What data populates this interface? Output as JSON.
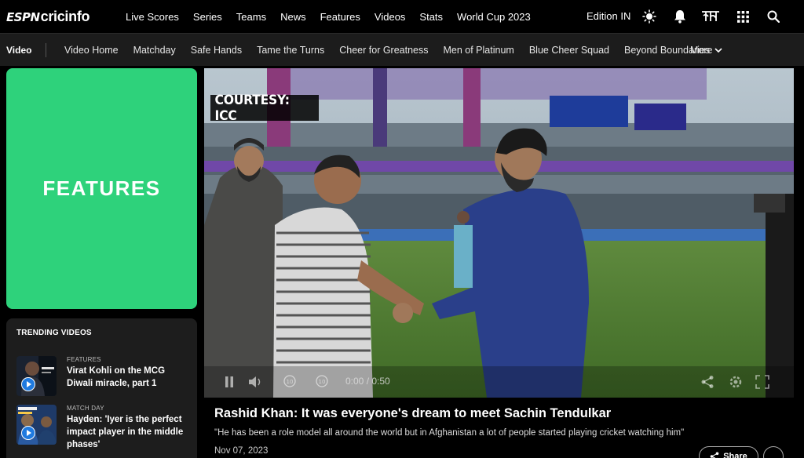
{
  "brand": {
    "espn": "ESPN",
    "cricinfo": "cricinfo"
  },
  "topnav": {
    "links": [
      "Live Scores",
      "Series",
      "Teams",
      "News",
      "Features",
      "Videos",
      "Stats",
      "World Cup 2023"
    ],
    "edition": "Edition IN",
    "icons": [
      "brightness-icon",
      "notification-bell-icon",
      "hindi-language-icon",
      "apps-grid-icon",
      "search-icon"
    ]
  },
  "subnav": {
    "section": "Video",
    "links": [
      "Video Home",
      "Matchday",
      "Safe Hands",
      "Tame the Turns",
      "Cheer for Greatness",
      "Men of Platinum",
      "Blue Cheer Squad",
      "Beyond Boundaries"
    ],
    "more": "More"
  },
  "features_card": {
    "label": "FEATURES",
    "color": "#2ed27b"
  },
  "trending": {
    "heading": "TRENDING VIDEOS",
    "items": [
      {
        "category": "FEATURES",
        "title": "Virat Kohli on the MCG Diwali miracle, part 1"
      },
      {
        "category": "MATCH DAY",
        "title": "Hayden: 'Iyer is the perfect impact player in the middle phases'"
      }
    ]
  },
  "video": {
    "watermark": "COURTESY: ICC",
    "time": "0:00 / 0:50",
    "headline": "Rashid Khan: It was everyone's dream to meet Sachin Tendulkar",
    "summary": "\"He has been a role model all around the world but in Afghanistan a lot of people started playing cricket watching him\"",
    "date": "Nov 07, 2023",
    "share_label": "Share"
  }
}
